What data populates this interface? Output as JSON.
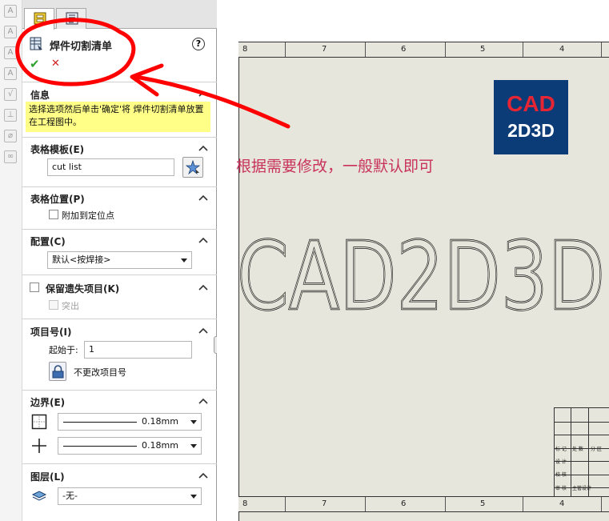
{
  "toolbar": {
    "icons": [
      "note-icon",
      "smart-dimension-icon",
      "balloon-icon",
      "auto-balloon-icon",
      "surface-finish-icon",
      "weld-symbol-icon",
      "hole-callout-icon",
      "geometric-tolerance-icon"
    ]
  },
  "tabs": [
    {
      "name": "property-manager-tab",
      "active": true
    },
    {
      "name": "configuration-tab",
      "active": false
    }
  ],
  "header": {
    "title": "焊件切割清单",
    "help": "?",
    "ok": "✔",
    "cancel": "✕"
  },
  "info": {
    "title": "信息",
    "message": "选择选项然后单击'确定'将 焊件切割清单放置在工程图中。"
  },
  "template": {
    "title": "表格模板(E)",
    "value": "cut list"
  },
  "position": {
    "title": "表格位置(P)",
    "attach_label": "附加到定位点"
  },
  "config": {
    "title": "配置(C)",
    "selected": "默认<按焊接>"
  },
  "keep_missing": {
    "title": "保留遗失项目(K)",
    "strike_label": "突出"
  },
  "item_number": {
    "title": "项目号(I)",
    "start_label": "起始于:",
    "start_value": "1",
    "keep_label": "不更改项目号"
  },
  "border": {
    "title": "边界(E)",
    "outer_value": "0.18mm",
    "inner_value": "0.18mm"
  },
  "layer": {
    "title": "图层(L)",
    "selected": "-无-"
  },
  "drawing": {
    "zone_numbers": [
      "8",
      "7",
      "6",
      "5",
      "4"
    ],
    "logo_line1": "CAD",
    "logo_line2": "2D3D",
    "annotation": "根据需要修改，一般默认即可",
    "big_text": "CAD2D3D",
    "titleblock": [
      "标 记",
      "处 数",
      "分 区",
      "设 计",
      "校 核",
      "审 核",
      "主管设计"
    ]
  },
  "colors": {
    "annotation": "#c8325b",
    "marker": "#ff0000",
    "logo_bg": "#0c3c77",
    "logo_red": "#e52533",
    "info_bg": "#ffff88"
  }
}
